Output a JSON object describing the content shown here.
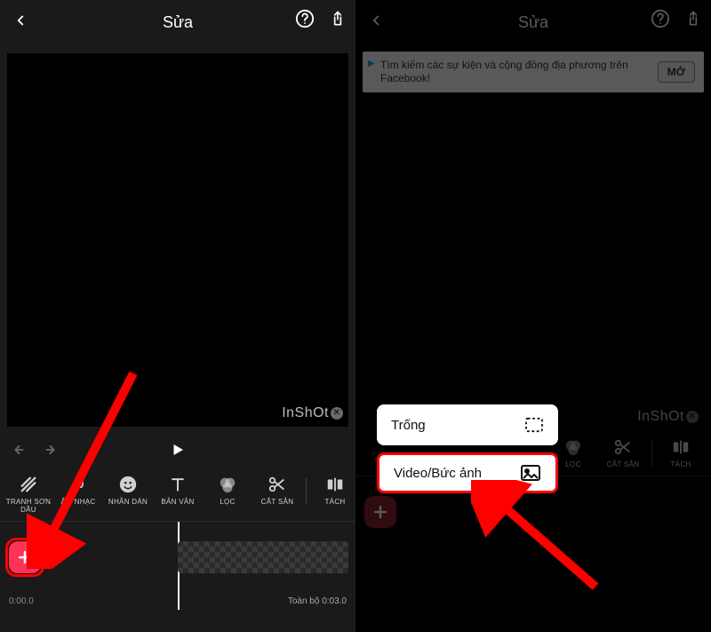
{
  "left": {
    "header": {
      "title": "Sửa"
    },
    "watermark": "InShOt",
    "tools": [
      {
        "label": "TRANH SƠN DẦU"
      },
      {
        "label": "ÂM NHẠC"
      },
      {
        "label": "NHÃN DÁN"
      },
      {
        "label": "BẢN VĂN"
      },
      {
        "label": "LỌC"
      },
      {
        "label": "CẮT SẴN"
      },
      {
        "label": "TÁCH"
      }
    ],
    "timeline": {
      "current": "0:00.0",
      "total": "Toàn bộ 0:03.0"
    }
  },
  "right": {
    "header": {
      "title": "Sửa"
    },
    "ad": {
      "text": "Tìm kiếm các sự kiện và cộng đồng địa phương trên Facebook!",
      "button": "MỞ"
    },
    "watermark": "InShOt",
    "popup": {
      "option1": "Trống",
      "option2": "Video/Bức ảnh"
    },
    "tools": [
      {
        "label": "LỌC"
      },
      {
        "label": "CẮT SẴN"
      },
      {
        "label": "TÁCH"
      }
    ]
  }
}
